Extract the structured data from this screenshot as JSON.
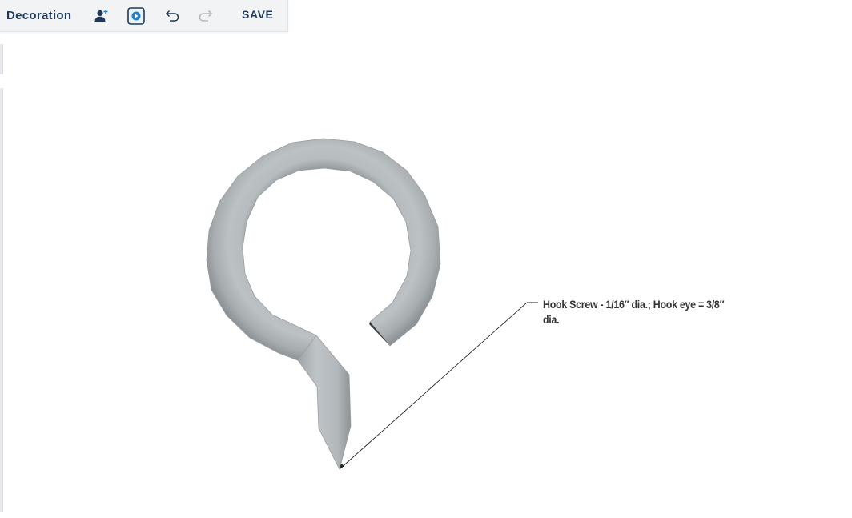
{
  "toolbar": {
    "title": "Decoration",
    "save_label": "SAVE",
    "icons": {
      "add_user": "add-user-icon",
      "play": "play-icon",
      "undo": "undo-icon",
      "redo": "redo-icon"
    }
  },
  "annotation": {
    "text": "Hook Screw - 1/16″ dia.; Hook eye = 3/8″ dia."
  },
  "colors": {
    "accent": "#1f3a5a",
    "play_highlight": "#2a7fc1",
    "toolbar_bg": "#f2f3f5",
    "model_fill": "#b4b9bc"
  }
}
